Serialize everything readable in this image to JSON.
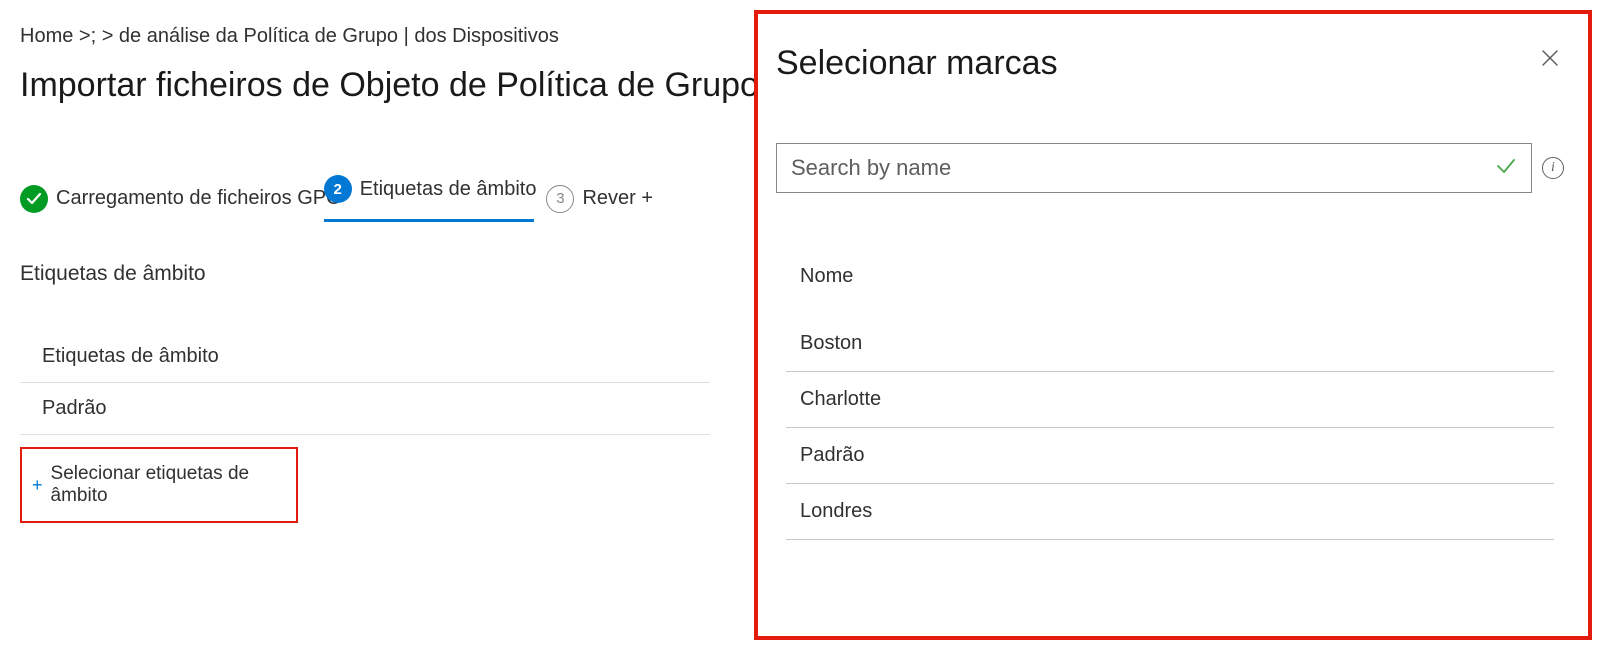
{
  "breadcrumb": "Home >;  > de análise da Política de Grupo | dos Dispositivos",
  "page_title": "Importar ficheiros de Objeto de Política de Grupo",
  "steps": {
    "done": {
      "label": "Carregamento de ficheiros GPO"
    },
    "active": {
      "num": "2",
      "label": "Etiquetas de âmbito"
    },
    "todo": {
      "num": "3",
      "label": "Rever +"
    }
  },
  "section_label": "Etiquetas de âmbito",
  "tags": {
    "column_head": "Etiquetas de âmbito",
    "rows": [
      "Padrão"
    ]
  },
  "select_tags_label": "Selecionar etiquetas de âmbito",
  "panel": {
    "title": "Selecionar marcas",
    "search_placeholder": "Search by name",
    "list_head": "Nome",
    "items": [
      "Boston",
      "Charlotte",
      "Padrão",
      "Londres"
    ]
  }
}
